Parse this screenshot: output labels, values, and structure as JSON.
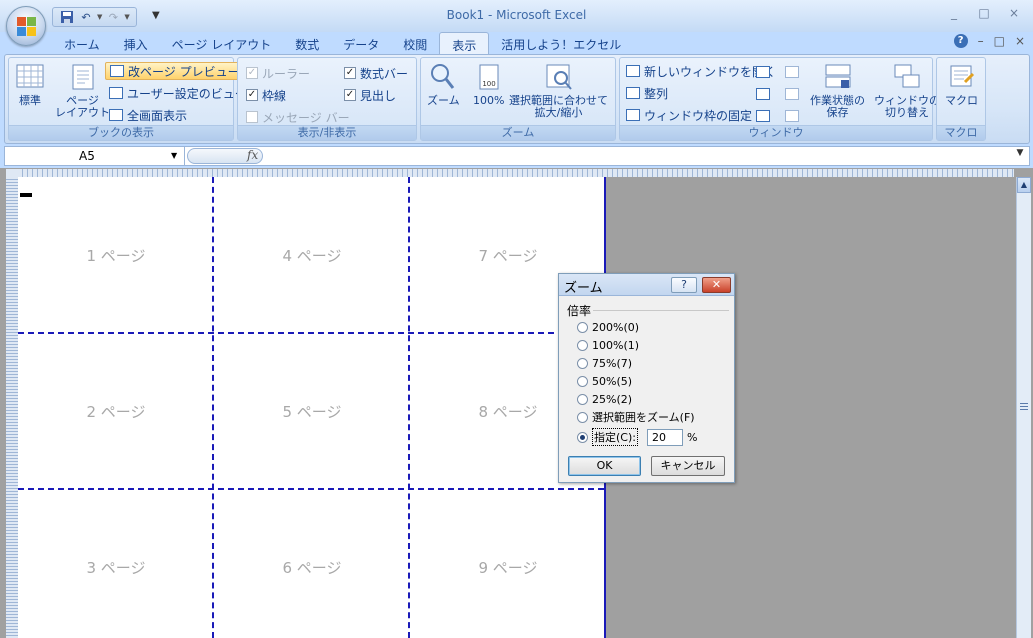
{
  "title": "Book1 - Microsoft Excel",
  "window_controls": [
    "_",
    "□",
    "×"
  ],
  "ribbon_window_controls": [
    "–",
    "□",
    "×"
  ],
  "tabs": [
    "ホーム",
    "挿入",
    "ページ レイアウト",
    "数式",
    "データ",
    "校閲",
    "表示",
    "活用しよう！エクセル"
  ],
  "active_tab": "表示",
  "groups": {
    "book_view": {
      "label": "ブックの表示",
      "normal": "標準",
      "page_layout": "ページ\nレイアウト",
      "page_break_preview": "改ページ プレビュー",
      "custom_views": "ユーザー設定のビュー",
      "full_screen": "全画面表示"
    },
    "show_hide": {
      "label": "表示/非表示",
      "ruler": "ルーラー",
      "formula_bar": "数式バー",
      "gridlines": "枠線",
      "headings": "見出し",
      "message_bar": "メッセージ バー"
    },
    "zoom": {
      "label": "ズーム",
      "zoom": "ズーム",
      "hundred": "100%",
      "zoom_selection": "選択範囲に合わせて\n拡大/縮小"
    },
    "window": {
      "label": "ウィンドウ",
      "new_window": "新しいウィンドウを開く",
      "arrange": "整列",
      "freeze": "ウィンドウ枠の固定",
      "save_workspace": "作業状態の\n保存",
      "switch_windows": "ウィンドウの\n切り替え"
    },
    "macro": {
      "label": "マクロ",
      "macro": "マクロ"
    }
  },
  "checkbox_states": {
    "ruler": true,
    "formula_bar": true,
    "gridlines": true,
    "headings": true,
    "message_bar": false
  },
  "name_box": "A5",
  "fx_label": "fx",
  "pages": [
    "1 ページ",
    "4 ページ",
    "7 ページ",
    "2 ページ",
    "5 ページ",
    "8 ページ",
    "3 ページ",
    "6 ページ",
    "9 ページ"
  ],
  "dialog": {
    "title": "ズーム",
    "help": "?",
    "close": "✕",
    "group_label": "倍率",
    "options": [
      "200%(0)",
      "100%(1)",
      "75%(7)",
      "50%(5)",
      "25%(2)",
      "選択範囲をズーム(F)",
      "指定(C):"
    ],
    "selected_option": "指定(C):",
    "custom_value": "20",
    "percent": "%",
    "ok": "OK",
    "cancel": "キャンセル"
  },
  "colors": {
    "page_break": "#1a1ab8",
    "ribbon_bg": "#d7e6f8",
    "highlight": "#ffd26b"
  }
}
